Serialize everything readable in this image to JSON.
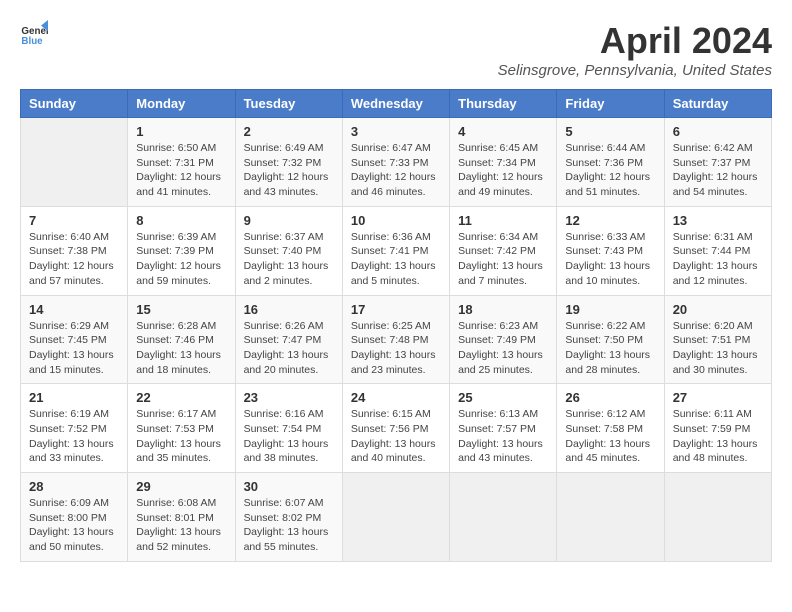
{
  "header": {
    "logo_general": "General",
    "logo_blue": "Blue",
    "month_year": "April 2024",
    "location": "Selinsgrove, Pennsylvania, United States"
  },
  "days_of_week": [
    "Sunday",
    "Monday",
    "Tuesday",
    "Wednesday",
    "Thursday",
    "Friday",
    "Saturday"
  ],
  "weeks": [
    [
      {
        "day": "",
        "info": ""
      },
      {
        "day": "1",
        "info": "Sunrise: 6:50 AM\nSunset: 7:31 PM\nDaylight: 12 hours\nand 41 minutes."
      },
      {
        "day": "2",
        "info": "Sunrise: 6:49 AM\nSunset: 7:32 PM\nDaylight: 12 hours\nand 43 minutes."
      },
      {
        "day": "3",
        "info": "Sunrise: 6:47 AM\nSunset: 7:33 PM\nDaylight: 12 hours\nand 46 minutes."
      },
      {
        "day": "4",
        "info": "Sunrise: 6:45 AM\nSunset: 7:34 PM\nDaylight: 12 hours\nand 49 minutes."
      },
      {
        "day": "5",
        "info": "Sunrise: 6:44 AM\nSunset: 7:36 PM\nDaylight: 12 hours\nand 51 minutes."
      },
      {
        "day": "6",
        "info": "Sunrise: 6:42 AM\nSunset: 7:37 PM\nDaylight: 12 hours\nand 54 minutes."
      }
    ],
    [
      {
        "day": "7",
        "info": "Sunrise: 6:40 AM\nSunset: 7:38 PM\nDaylight: 12 hours\nand 57 minutes."
      },
      {
        "day": "8",
        "info": "Sunrise: 6:39 AM\nSunset: 7:39 PM\nDaylight: 12 hours\nand 59 minutes."
      },
      {
        "day": "9",
        "info": "Sunrise: 6:37 AM\nSunset: 7:40 PM\nDaylight: 13 hours\nand 2 minutes."
      },
      {
        "day": "10",
        "info": "Sunrise: 6:36 AM\nSunset: 7:41 PM\nDaylight: 13 hours\nand 5 minutes."
      },
      {
        "day": "11",
        "info": "Sunrise: 6:34 AM\nSunset: 7:42 PM\nDaylight: 13 hours\nand 7 minutes."
      },
      {
        "day": "12",
        "info": "Sunrise: 6:33 AM\nSunset: 7:43 PM\nDaylight: 13 hours\nand 10 minutes."
      },
      {
        "day": "13",
        "info": "Sunrise: 6:31 AM\nSunset: 7:44 PM\nDaylight: 13 hours\nand 12 minutes."
      }
    ],
    [
      {
        "day": "14",
        "info": "Sunrise: 6:29 AM\nSunset: 7:45 PM\nDaylight: 13 hours\nand 15 minutes."
      },
      {
        "day": "15",
        "info": "Sunrise: 6:28 AM\nSunset: 7:46 PM\nDaylight: 13 hours\nand 18 minutes."
      },
      {
        "day": "16",
        "info": "Sunrise: 6:26 AM\nSunset: 7:47 PM\nDaylight: 13 hours\nand 20 minutes."
      },
      {
        "day": "17",
        "info": "Sunrise: 6:25 AM\nSunset: 7:48 PM\nDaylight: 13 hours\nand 23 minutes."
      },
      {
        "day": "18",
        "info": "Sunrise: 6:23 AM\nSunset: 7:49 PM\nDaylight: 13 hours\nand 25 minutes."
      },
      {
        "day": "19",
        "info": "Sunrise: 6:22 AM\nSunset: 7:50 PM\nDaylight: 13 hours\nand 28 minutes."
      },
      {
        "day": "20",
        "info": "Sunrise: 6:20 AM\nSunset: 7:51 PM\nDaylight: 13 hours\nand 30 minutes."
      }
    ],
    [
      {
        "day": "21",
        "info": "Sunrise: 6:19 AM\nSunset: 7:52 PM\nDaylight: 13 hours\nand 33 minutes."
      },
      {
        "day": "22",
        "info": "Sunrise: 6:17 AM\nSunset: 7:53 PM\nDaylight: 13 hours\nand 35 minutes."
      },
      {
        "day": "23",
        "info": "Sunrise: 6:16 AM\nSunset: 7:54 PM\nDaylight: 13 hours\nand 38 minutes."
      },
      {
        "day": "24",
        "info": "Sunrise: 6:15 AM\nSunset: 7:56 PM\nDaylight: 13 hours\nand 40 minutes."
      },
      {
        "day": "25",
        "info": "Sunrise: 6:13 AM\nSunset: 7:57 PM\nDaylight: 13 hours\nand 43 minutes."
      },
      {
        "day": "26",
        "info": "Sunrise: 6:12 AM\nSunset: 7:58 PM\nDaylight: 13 hours\nand 45 minutes."
      },
      {
        "day": "27",
        "info": "Sunrise: 6:11 AM\nSunset: 7:59 PM\nDaylight: 13 hours\nand 48 minutes."
      }
    ],
    [
      {
        "day": "28",
        "info": "Sunrise: 6:09 AM\nSunset: 8:00 PM\nDaylight: 13 hours\nand 50 minutes."
      },
      {
        "day": "29",
        "info": "Sunrise: 6:08 AM\nSunset: 8:01 PM\nDaylight: 13 hours\nand 52 minutes."
      },
      {
        "day": "30",
        "info": "Sunrise: 6:07 AM\nSunset: 8:02 PM\nDaylight: 13 hours\nand 55 minutes."
      },
      {
        "day": "",
        "info": ""
      },
      {
        "day": "",
        "info": ""
      },
      {
        "day": "",
        "info": ""
      },
      {
        "day": "",
        "info": ""
      }
    ]
  ]
}
